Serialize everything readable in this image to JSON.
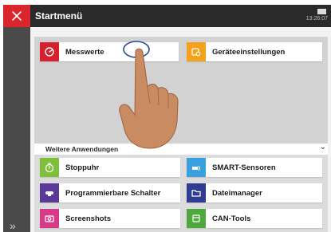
{
  "titlebar": {
    "title": "Startmenü",
    "clock": "13:26:07",
    "close_color": "#d9252b"
  },
  "favorites": [
    {
      "label": "Messwerte",
      "icon": "gauge-icon",
      "color": "#d7202d"
    },
    {
      "label": "Geräteeinstellungen",
      "icon": "settings-cog-icon",
      "color": "#f4a11c"
    }
  ],
  "more_apps": {
    "label": "Weitere Anwendungen",
    "items": [
      {
        "label": "Stoppuhr",
        "icon": "stopwatch-icon",
        "color": "#7fbf3b"
      },
      {
        "label": "SMART-Sensoren",
        "icon": "smart-sensor-icon",
        "color": "#3aa0e0"
      },
      {
        "label": "Programmierbare Schalter",
        "icon": "switch-icon",
        "color": "#5a3a96"
      },
      {
        "label": "Dateimanager",
        "icon": "folder-icon",
        "color": "#2e3d8f"
      },
      {
        "label": "Screenshots",
        "icon": "camera-icon",
        "color": "#d63b8a"
      },
      {
        "label": "CAN-Tools",
        "icon": "can-tools-icon",
        "color": "#4fa83d"
      }
    ]
  }
}
